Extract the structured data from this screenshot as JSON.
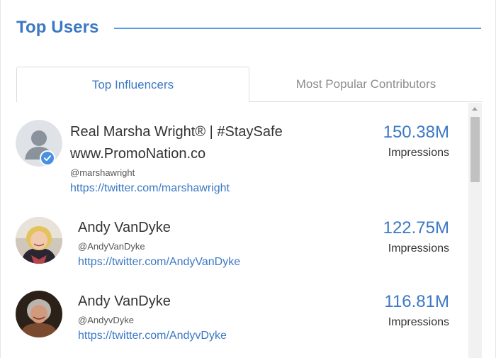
{
  "header": {
    "title": "Top Users"
  },
  "tabs": [
    {
      "label": "Top Influencers",
      "active": true
    },
    {
      "label": "Most Popular Contributors",
      "active": false
    }
  ],
  "users": [
    {
      "name_line1": "Real Marsha Wright® | #StaySafe",
      "name_line2": "www.PromoNation.co",
      "handle": "@marshawright",
      "url": "https://twitter.com/marshawright",
      "impressions": "150.38M",
      "impressions_label": "Impressions",
      "avatar": "default-user-icon",
      "verified": true
    },
    {
      "name_line1": "Andy VanDyke",
      "handle": "@AndyVanDyke",
      "url": "https://twitter.com/AndyVanDyke",
      "impressions": "122.75M",
      "impressions_label": "Impressions",
      "avatar": "profile-photo"
    },
    {
      "name_line1": "Andy VanDyke",
      "handle": "@AndyvDyke",
      "url": "https://twitter.com/AndyvDyke",
      "impressions": "116.81M",
      "impressions_label": "Impressions",
      "avatar": "profile-photo"
    }
  ],
  "colors": {
    "accent": "#3b78c4",
    "rule": "#5a9ae0",
    "verified": "#4a90e2"
  }
}
